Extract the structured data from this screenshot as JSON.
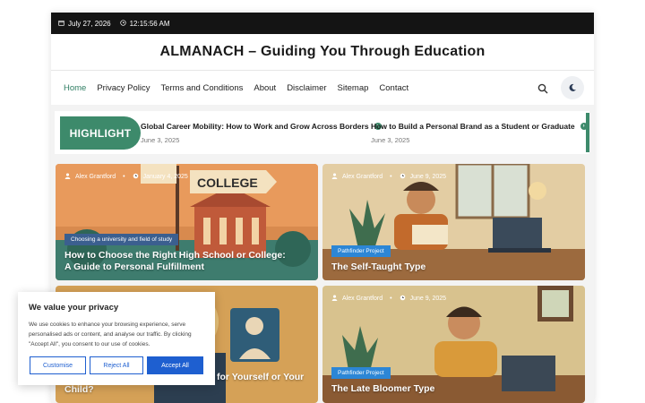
{
  "topbar": {
    "date": "July 27, 2026",
    "time": "12:15:56 AM"
  },
  "site": {
    "title": "ALMANACH – Guiding You Through Education"
  },
  "nav": {
    "items": [
      "Home",
      "Privacy Policy",
      "Terms and Conditions",
      "About",
      "Disclaimer",
      "Sitemap",
      "Contact"
    ]
  },
  "highlight": {
    "badge": "HIGHLIGHT",
    "items": [
      {
        "title": "Global Career Mobility: How to Work and Grow Across Borders",
        "date": "June 3, 2025"
      },
      {
        "title": "How to Build a Personal Brand as a Student or Graduate",
        "date": "June 3, 2025"
      }
    ]
  },
  "cards": [
    {
      "author": "Alex Grantford",
      "date": "January 4, 2025",
      "tag": "Choosing a university and field of study",
      "title": "How to Choose the Right High School or College: A Guide to Personal Fulfillment",
      "illustration_text": "COLLEGE"
    },
    {
      "author": "Alex Grantford",
      "date": "June 9, 2025",
      "tag": "Pathfinder Project",
      "title": "The Self-Taught Type"
    },
    {
      "title_visible": "for Yourself or Your",
      "title_line2": "Child?"
    },
    {
      "author": "Alex Grantford",
      "date": "June 9, 2025",
      "tag": "Pathfinder Project",
      "title": "The Late Bloomer Type"
    }
  ],
  "cookie": {
    "title": "We value your privacy",
    "text": "We use cookies to enhance your browsing experience, serve personalised ads or content, and analyse our traffic. By clicking \"Accept All\", you consent to our use of cookies.",
    "buttons": {
      "customise": "Customise",
      "reject": "Reject All",
      "accept": "Accept All"
    }
  },
  "colors": {
    "accent": "#3d8a6b",
    "topbar": "#141414",
    "tag_blue": "#2c86d6",
    "cookie_button": "#1e5fd0"
  }
}
